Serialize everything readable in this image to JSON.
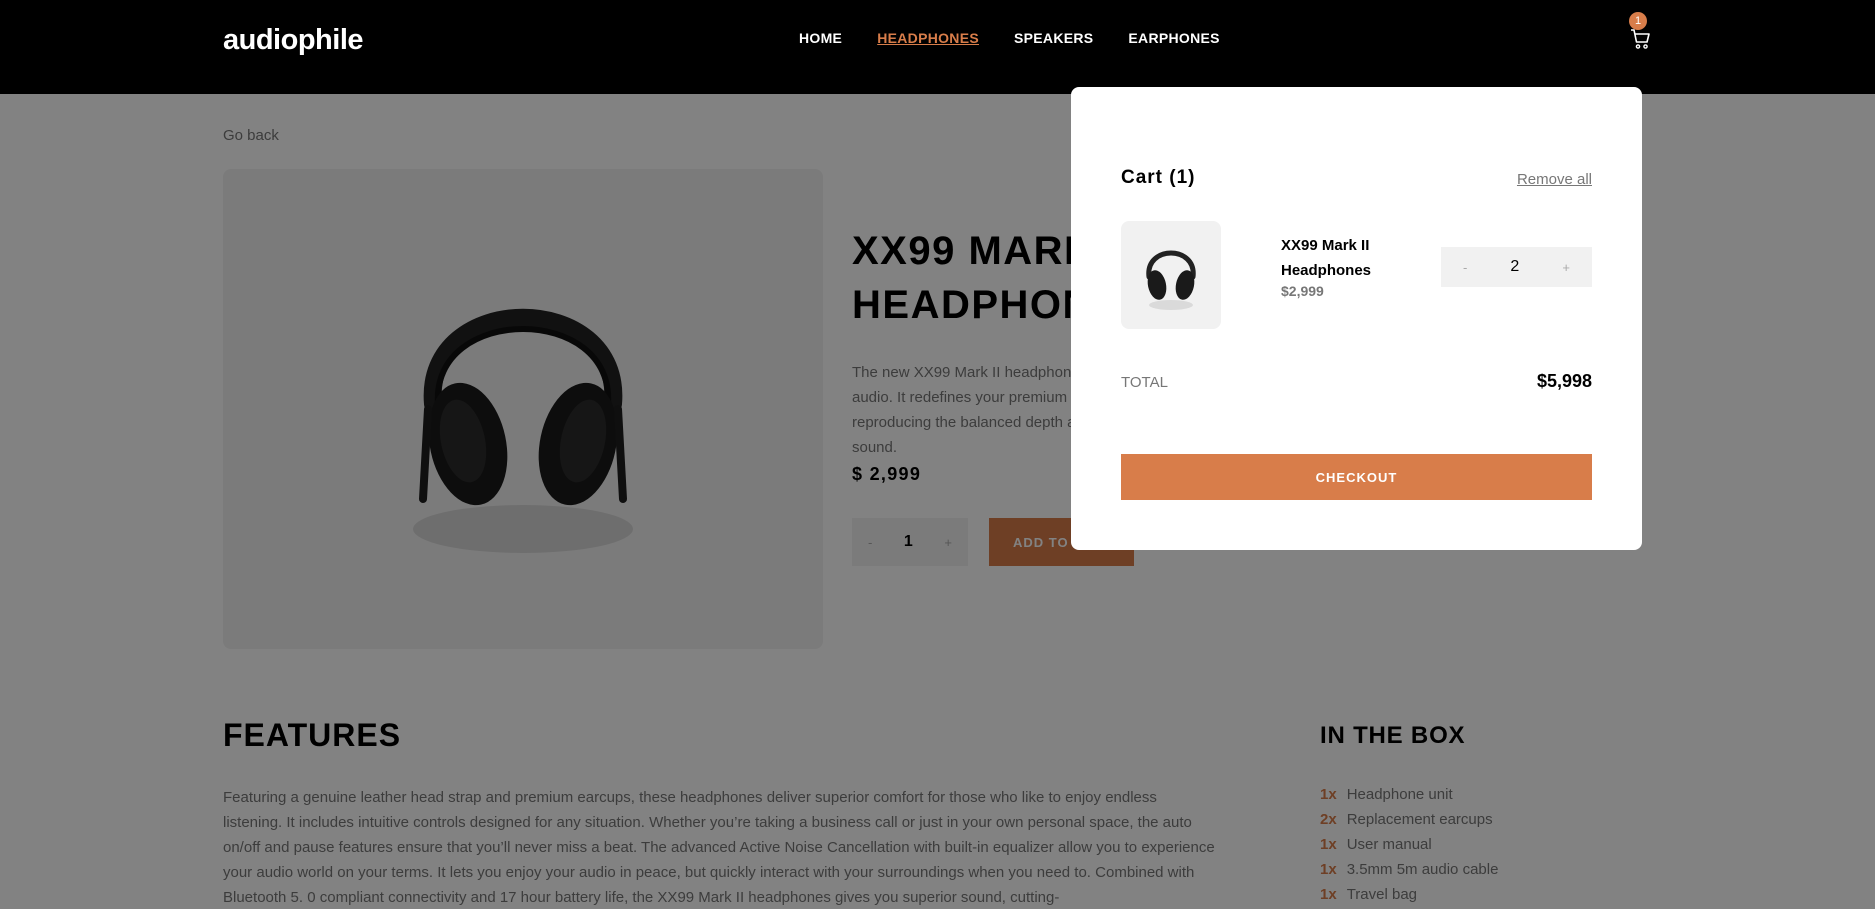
{
  "header": {
    "logo": "audiophile",
    "nav": [
      "HOME",
      "HEADPHONES",
      "SPEAKERS",
      "EARPHONES"
    ],
    "active_nav": "HEADPHONES",
    "cart_count": "1"
  },
  "product": {
    "go_back": "Go back",
    "title": "XX99 MARK II\nHEADPHONES",
    "description": "The new XX99 Mark II headphones is the pinnacle of pristine audio. It redefines your premium headphone experience by reproducing the balanced depth and precision of studio-quality sound.",
    "price": "$ 2,999",
    "quantity": "1",
    "qty_minus": "-",
    "qty_plus": "+",
    "add_to_cart": "ADD TO CART"
  },
  "features": {
    "title": "FEATURES",
    "text": "Featuring a genuine leather head strap and premium earcups, these headphones deliver superior comfort for those who like to enjoy endless listening. It includes intuitive controls designed for any situation. Whether you’re taking a business call or just in your own personal space, the auto on/off and pause features ensure that you’ll never miss a beat. The advanced Active Noise Cancellation with built-in equalizer allow you to experience your audio world on your terms. It lets you enjoy your audio in peace, but quickly interact with your surroundings when you need to. Combined with Bluetooth 5. 0 compliant connectivity and 17 hour battery life, the XX99 Mark II headphones gives you superior sound, cutting-"
  },
  "in_the_box": {
    "title": "IN THE BOX",
    "items": [
      {
        "count": "1x",
        "label": "Headphone unit"
      },
      {
        "count": "2x",
        "label": "Replacement earcups"
      },
      {
        "count": "1x",
        "label": "User manual"
      },
      {
        "count": "1x",
        "label": "3.5mm 5m audio cable"
      },
      {
        "count": "1x",
        "label": "Travel bag"
      }
    ]
  },
  "cart": {
    "title": "Cart (1)",
    "remove_all": "Remove all",
    "item": {
      "name": "XX99 Mark II\nHeadphones",
      "price": "$2,999",
      "quantity": "2",
      "qty_minus": "-",
      "qty_plus": "+"
    },
    "total_label": "TOTAL",
    "total_value": "$5,998",
    "checkout": "CHECKOUT"
  },
  "colors": {
    "accent": "#d87d4a",
    "header_bg": "#000000",
    "overlay": "rgba(0,0,0,0.49)"
  },
  "icons": [
    "cart-icon",
    "headphones-image"
  ]
}
